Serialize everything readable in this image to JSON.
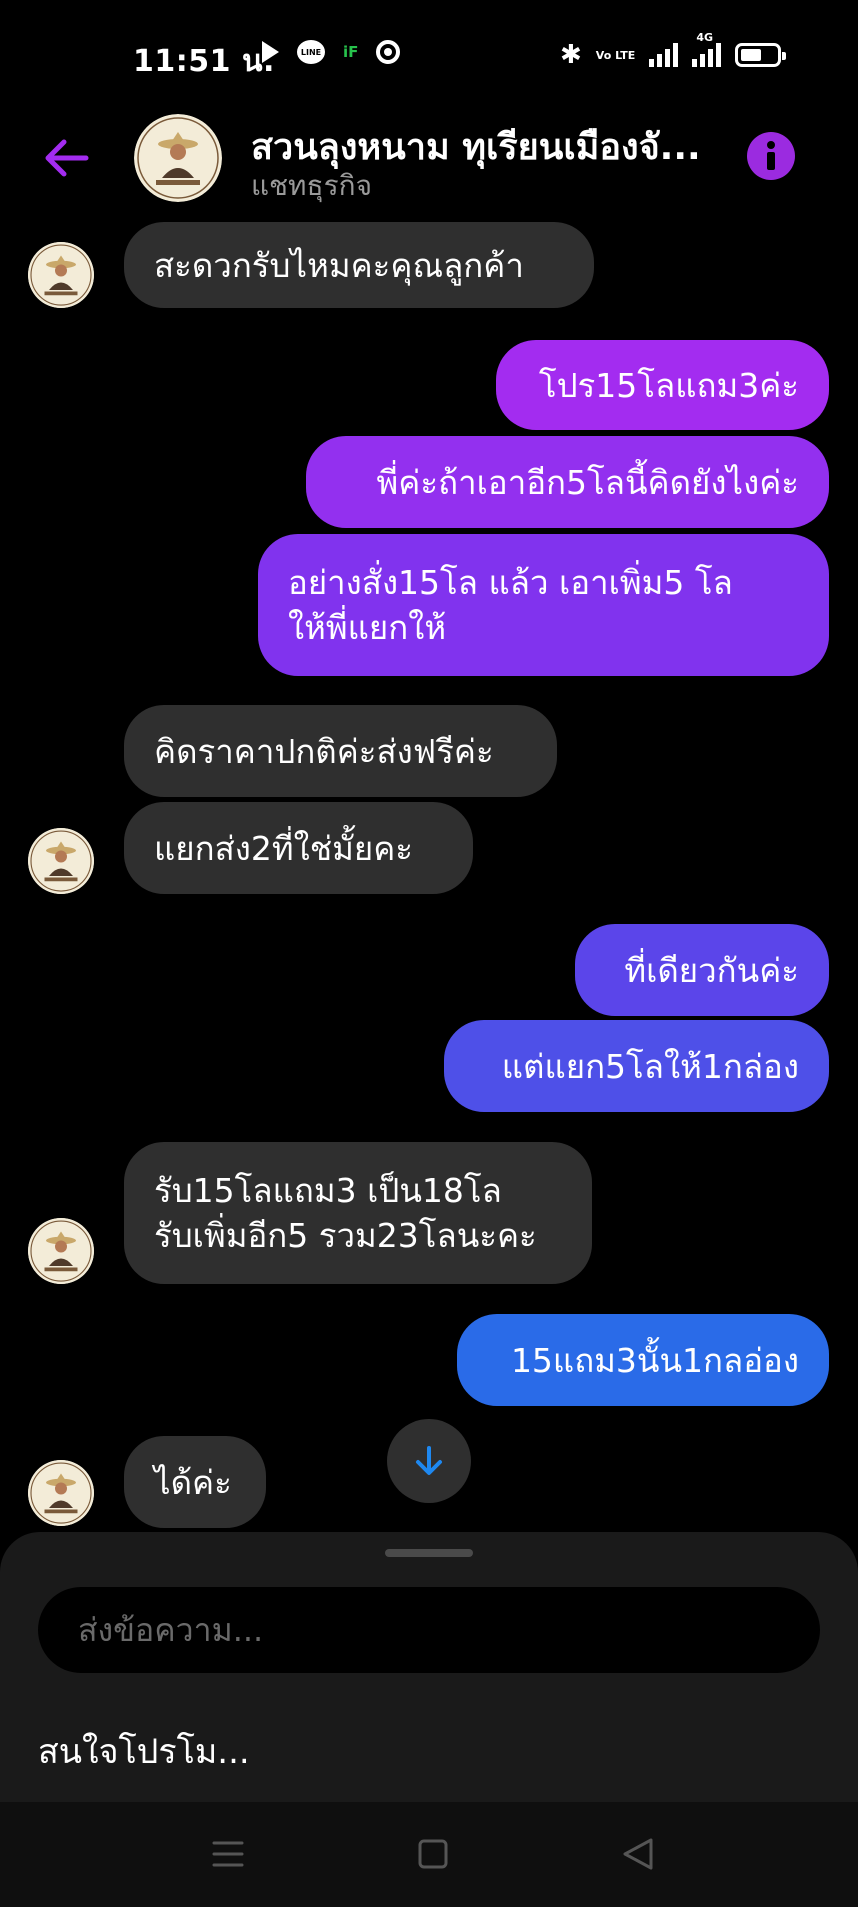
{
  "status_bar": {
    "time": "11:51 น.",
    "line_label": "LINE",
    "if_label": "iF",
    "volte_label": "Vo LTE",
    "network_label": "4G"
  },
  "header": {
    "title": "สวนลุงหนาม ทุเรียนเมืองจั...",
    "subtitle": "แชทธุรกิจ"
  },
  "colors": {
    "accent": "#9b2be0",
    "incoming_bubble": "#2f2f2f",
    "background": "#000000"
  },
  "messages": [
    {
      "direction": "in",
      "lines": [
        "สะดวกรับไหมคะคุณลูกค้า"
      ],
      "color": "#2f2f2f"
    },
    {
      "direction": "out",
      "lines": [
        "โปร15โลแถม3ค่ะ"
      ],
      "color": "#a32cf0"
    },
    {
      "direction": "out",
      "lines": [
        "พี่ค่ะถ้าเอาอีก5โลนี้คิดยังไงค่ะ"
      ],
      "color": "#9330ef"
    },
    {
      "direction": "out",
      "lines": [
        "อย่างสั่ง15โล แล้ว เอาเพิ่ม5 โล",
        "ให้พี่แยกให้"
      ],
      "color": "#8133ee"
    },
    {
      "direction": "in",
      "lines": [
        "คิดราคาปกติค่ะส่งฟรีค่ะ"
      ],
      "color": "#2f2f2f"
    },
    {
      "direction": "in",
      "lines": [
        "แยกส่ง2ที่ใช่มั้ยคะ"
      ],
      "color": "#2f2f2f"
    },
    {
      "direction": "out",
      "lines": [
        "ที่เดียวกันค่ะ"
      ],
      "color": "#5b45ea"
    },
    {
      "direction": "out",
      "lines": [
        "แต่แยก5โลให้1กล่อง"
      ],
      "color": "#4e50e8"
    },
    {
      "direction": "in",
      "lines": [
        "รับ15โลแถม3 เป็น18โล",
        "รับเพิ่มอีก5 รวม23โลนะคะ"
      ],
      "color": "#2f2f2f"
    },
    {
      "direction": "out",
      "lines": [
        "15แถม3นั้น1กลอ่อง"
      ],
      "color": "#2a6be8"
    },
    {
      "direction": "in",
      "lines": [
        "ได้ค่ะ"
      ],
      "color": "#2f2f2f"
    }
  ],
  "composer": {
    "placeholder": "ส่งข้อความ...",
    "quick_reply": "สนใจโปรโม..."
  },
  "icons": {
    "back": "arrow-left-icon",
    "info": "info-icon",
    "scroll": "arrow-down-icon",
    "nav": [
      "menu-icon",
      "home-square-icon",
      "back-triangle-icon"
    ]
  }
}
